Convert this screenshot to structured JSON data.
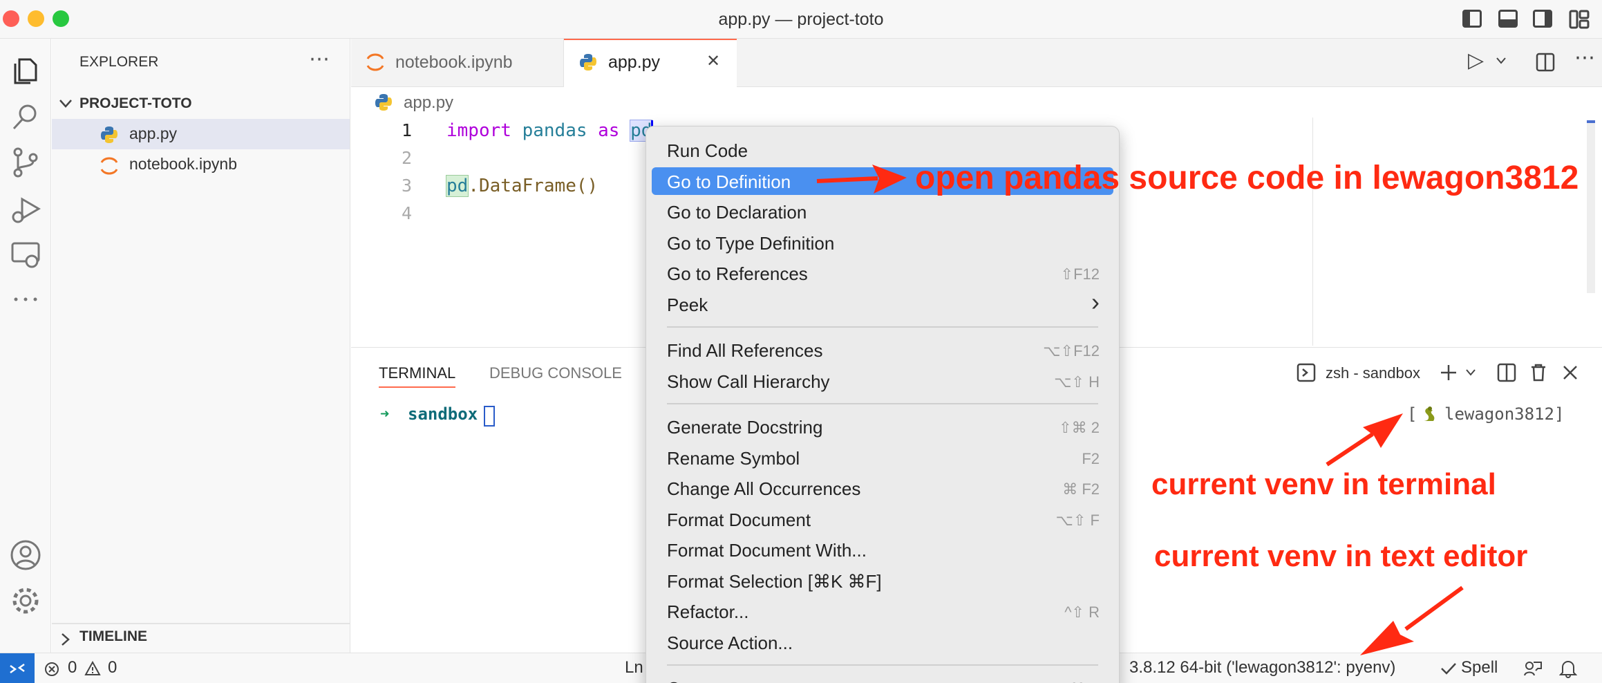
{
  "window": {
    "title": "app.py — project-toto"
  },
  "sidebar": {
    "header": "EXPLORER",
    "more_icon": "⋯",
    "project": "PROJECT-TOTO",
    "files": [
      {
        "name": "app.py",
        "icon": "python-icon"
      },
      {
        "name": "notebook.ipynb",
        "icon": "jupyter-icon"
      }
    ],
    "timeline": "TIMELINE"
  },
  "tabs": [
    {
      "label": "notebook.ipynb",
      "icon": "jupyter-icon",
      "active": false
    },
    {
      "label": "app.py",
      "icon": "python-icon",
      "active": true,
      "close": "✕"
    }
  ],
  "editor_actions": {
    "run": "▷",
    "more": "⋯"
  },
  "breadcrumb": "app.py",
  "code": {
    "line_numbers": [
      "1",
      "2",
      "3",
      "4"
    ],
    "line1": {
      "kw_import": "import",
      "module": "pandas",
      "kw_as": "as",
      "alias": "pd"
    },
    "line3": {
      "obj": "pd",
      "rest": ".DataFrame()"
    }
  },
  "panel": {
    "tabs": [
      "TERMINAL",
      "DEBUG CONSOLE"
    ],
    "terminal_name": "zsh - sandbox",
    "prompt_arrow": "➜",
    "prompt_dir": "sandbox",
    "venv_open": "[",
    "venv_name": "lewagon3812]"
  },
  "context_menu": {
    "groups": [
      [
        {
          "label": "Run Code",
          "shortcut": ""
        },
        {
          "label": "Go to Definition",
          "shortcut": "",
          "highlighted": true
        },
        {
          "label": "Go to Declaration",
          "shortcut": ""
        },
        {
          "label": "Go to Type Definition",
          "shortcut": ""
        },
        {
          "label": "Go to References",
          "shortcut": "⇧F12"
        },
        {
          "label": "Peek",
          "shortcut": "›"
        }
      ],
      [
        {
          "label": "Find All References",
          "shortcut": "⌥⇧F12"
        },
        {
          "label": "Show Call Hierarchy",
          "shortcut": "⌥⇧ H"
        }
      ],
      [
        {
          "label": "Generate Docstring",
          "shortcut": "⇧⌘ 2"
        },
        {
          "label": "Rename Symbol",
          "shortcut": "F2"
        },
        {
          "label": "Change All Occurrences",
          "shortcut": "⌘ F2"
        },
        {
          "label": "Format Document",
          "shortcut": "⌥⇧ F"
        },
        {
          "label": "Format Document With...",
          "shortcut": ""
        },
        {
          "label": "Format Selection [⌘K ⌘F]",
          "shortcut": ""
        },
        {
          "label": "Refactor...",
          "shortcut": "^⇧ R"
        },
        {
          "label": "Source Action...",
          "shortcut": ""
        }
      ],
      [
        {
          "label": "Cut",
          "shortcut": "⌘ X"
        }
      ]
    ],
    "highlight_color": "#4a90f0"
  },
  "statusbar": {
    "remote_icon": "remote-icon",
    "errors": "0",
    "warnings": "0",
    "position": "Ln",
    "interpreter": "3.8.12 64-bit ('lewagon3812': pyenv)",
    "spell": "Spell"
  },
  "annotations": {
    "definition": "open pandas source code in lewagon3812",
    "venv_terminal": "current venv in terminal",
    "venv_editor": "current venv in text editor",
    "color": "#ff2a12"
  }
}
